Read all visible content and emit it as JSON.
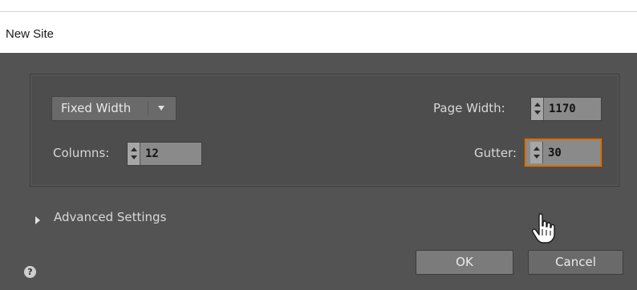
{
  "dialog": {
    "title": "New Site"
  },
  "grid_settings": {
    "layout_mode": {
      "selected": "Fixed Width"
    },
    "columns": {
      "label": "Columns:",
      "value": "12"
    },
    "page_width": {
      "label": "Page Width:",
      "value": "1170"
    },
    "gutter": {
      "label": "Gutter:",
      "value": "30"
    }
  },
  "advanced": {
    "label": "Advanced Settings"
  },
  "help": {
    "glyph": "?"
  },
  "buttons": {
    "ok": "OK",
    "cancel": "Cancel"
  },
  "colors": {
    "dialog_bg": "#535353",
    "panel_bg": "#4d4d4d",
    "focus_outline": "#c9721f"
  },
  "icons": [
    "caret-down-icon",
    "spin-arrows-icon",
    "disclosure-triangle-icon",
    "help-icon",
    "hand-cursor-icon"
  ]
}
